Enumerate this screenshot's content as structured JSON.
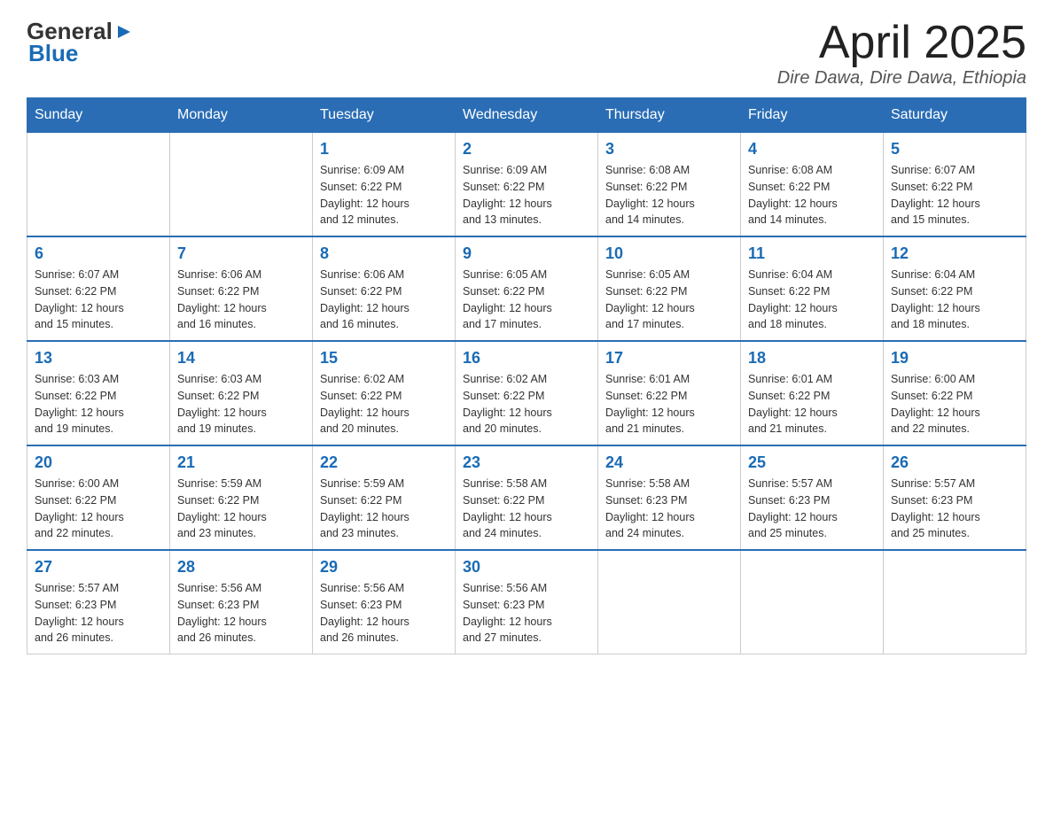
{
  "header": {
    "logo_general": "General",
    "logo_blue": "Blue",
    "month_title": "April 2025",
    "location": "Dire Dawa, Dire Dawa, Ethiopia"
  },
  "days_of_week": [
    "Sunday",
    "Monday",
    "Tuesday",
    "Wednesday",
    "Thursday",
    "Friday",
    "Saturday"
  ],
  "weeks": [
    [
      {
        "day": "",
        "info": ""
      },
      {
        "day": "",
        "info": ""
      },
      {
        "day": "1",
        "info": "Sunrise: 6:09 AM\nSunset: 6:22 PM\nDaylight: 12 hours\nand 12 minutes."
      },
      {
        "day": "2",
        "info": "Sunrise: 6:09 AM\nSunset: 6:22 PM\nDaylight: 12 hours\nand 13 minutes."
      },
      {
        "day": "3",
        "info": "Sunrise: 6:08 AM\nSunset: 6:22 PM\nDaylight: 12 hours\nand 14 minutes."
      },
      {
        "day": "4",
        "info": "Sunrise: 6:08 AM\nSunset: 6:22 PM\nDaylight: 12 hours\nand 14 minutes."
      },
      {
        "day": "5",
        "info": "Sunrise: 6:07 AM\nSunset: 6:22 PM\nDaylight: 12 hours\nand 15 minutes."
      }
    ],
    [
      {
        "day": "6",
        "info": "Sunrise: 6:07 AM\nSunset: 6:22 PM\nDaylight: 12 hours\nand 15 minutes."
      },
      {
        "day": "7",
        "info": "Sunrise: 6:06 AM\nSunset: 6:22 PM\nDaylight: 12 hours\nand 16 minutes."
      },
      {
        "day": "8",
        "info": "Sunrise: 6:06 AM\nSunset: 6:22 PM\nDaylight: 12 hours\nand 16 minutes."
      },
      {
        "day": "9",
        "info": "Sunrise: 6:05 AM\nSunset: 6:22 PM\nDaylight: 12 hours\nand 17 minutes."
      },
      {
        "day": "10",
        "info": "Sunrise: 6:05 AM\nSunset: 6:22 PM\nDaylight: 12 hours\nand 17 minutes."
      },
      {
        "day": "11",
        "info": "Sunrise: 6:04 AM\nSunset: 6:22 PM\nDaylight: 12 hours\nand 18 minutes."
      },
      {
        "day": "12",
        "info": "Sunrise: 6:04 AM\nSunset: 6:22 PM\nDaylight: 12 hours\nand 18 minutes."
      }
    ],
    [
      {
        "day": "13",
        "info": "Sunrise: 6:03 AM\nSunset: 6:22 PM\nDaylight: 12 hours\nand 19 minutes."
      },
      {
        "day": "14",
        "info": "Sunrise: 6:03 AM\nSunset: 6:22 PM\nDaylight: 12 hours\nand 19 minutes."
      },
      {
        "day": "15",
        "info": "Sunrise: 6:02 AM\nSunset: 6:22 PM\nDaylight: 12 hours\nand 20 minutes."
      },
      {
        "day": "16",
        "info": "Sunrise: 6:02 AM\nSunset: 6:22 PM\nDaylight: 12 hours\nand 20 minutes."
      },
      {
        "day": "17",
        "info": "Sunrise: 6:01 AM\nSunset: 6:22 PM\nDaylight: 12 hours\nand 21 minutes."
      },
      {
        "day": "18",
        "info": "Sunrise: 6:01 AM\nSunset: 6:22 PM\nDaylight: 12 hours\nand 21 minutes."
      },
      {
        "day": "19",
        "info": "Sunrise: 6:00 AM\nSunset: 6:22 PM\nDaylight: 12 hours\nand 22 minutes."
      }
    ],
    [
      {
        "day": "20",
        "info": "Sunrise: 6:00 AM\nSunset: 6:22 PM\nDaylight: 12 hours\nand 22 minutes."
      },
      {
        "day": "21",
        "info": "Sunrise: 5:59 AM\nSunset: 6:22 PM\nDaylight: 12 hours\nand 23 minutes."
      },
      {
        "day": "22",
        "info": "Sunrise: 5:59 AM\nSunset: 6:22 PM\nDaylight: 12 hours\nand 23 minutes."
      },
      {
        "day": "23",
        "info": "Sunrise: 5:58 AM\nSunset: 6:22 PM\nDaylight: 12 hours\nand 24 minutes."
      },
      {
        "day": "24",
        "info": "Sunrise: 5:58 AM\nSunset: 6:23 PM\nDaylight: 12 hours\nand 24 minutes."
      },
      {
        "day": "25",
        "info": "Sunrise: 5:57 AM\nSunset: 6:23 PM\nDaylight: 12 hours\nand 25 minutes."
      },
      {
        "day": "26",
        "info": "Sunrise: 5:57 AM\nSunset: 6:23 PM\nDaylight: 12 hours\nand 25 minutes."
      }
    ],
    [
      {
        "day": "27",
        "info": "Sunrise: 5:57 AM\nSunset: 6:23 PM\nDaylight: 12 hours\nand 26 minutes."
      },
      {
        "day": "28",
        "info": "Sunrise: 5:56 AM\nSunset: 6:23 PM\nDaylight: 12 hours\nand 26 minutes."
      },
      {
        "day": "29",
        "info": "Sunrise: 5:56 AM\nSunset: 6:23 PM\nDaylight: 12 hours\nand 26 minutes."
      },
      {
        "day": "30",
        "info": "Sunrise: 5:56 AM\nSunset: 6:23 PM\nDaylight: 12 hours\nand 27 minutes."
      },
      {
        "day": "",
        "info": ""
      },
      {
        "day": "",
        "info": ""
      },
      {
        "day": "",
        "info": ""
      }
    ]
  ]
}
